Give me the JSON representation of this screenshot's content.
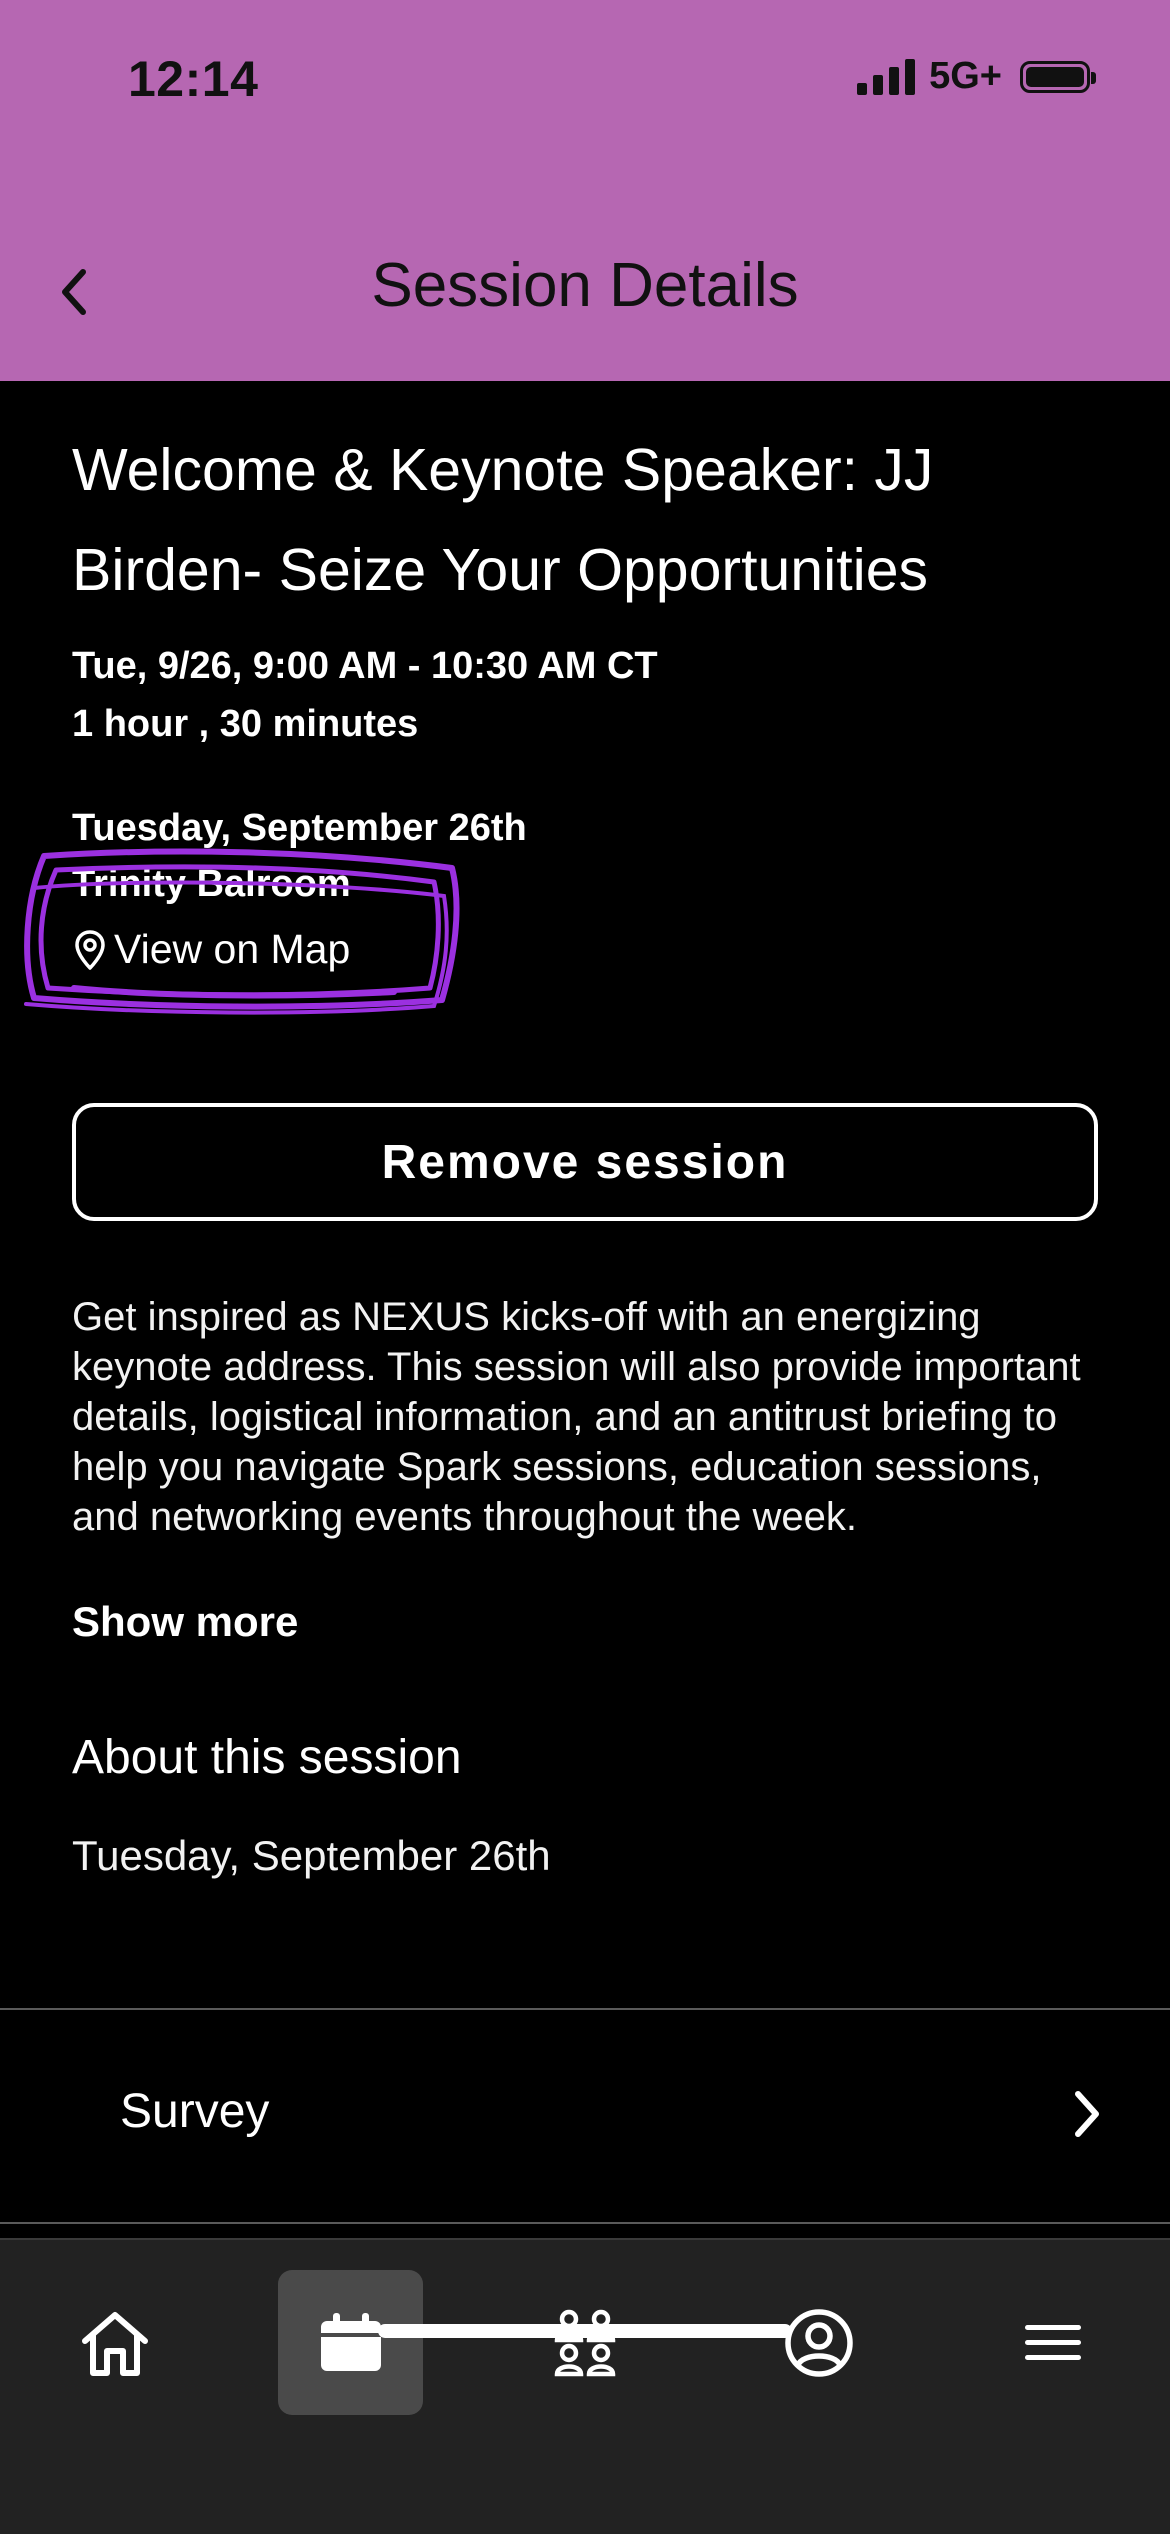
{
  "status_bar": {
    "time": "12:14",
    "network": "5G+"
  },
  "header": {
    "title": "Session Details"
  },
  "session": {
    "title": "Welcome & Keynote Speaker: JJ Birden- Seize Your Opportunities",
    "datetime": "Tue, 9/26, 9:00 AM - 10:30 AM CT",
    "duration": "1 hour , 30 minutes",
    "day": "Tuesday, September 26th",
    "room": "Trinity Balroom",
    "map_link": "View on Map",
    "remove_label": "Remove session",
    "description": "Get inspired as NEXUS kicks-off with an energizing keynote address. This session will also provide important details, logistical information, and an antitrust briefing to help you navigate Spark sessions, education sessions, and networking events throughout the week.",
    "show_more": "Show more"
  },
  "about": {
    "heading": "About this session",
    "date": "Tuesday, September 26th"
  },
  "survey": {
    "label": "Survey"
  },
  "tabbar": {
    "items": [
      {
        "icon": "home-icon",
        "active": false
      },
      {
        "icon": "calendar-icon",
        "active": true
      },
      {
        "icon": "people-icon",
        "active": false
      },
      {
        "icon": "profile-icon",
        "active": false
      },
      {
        "icon": "menu-icon",
        "active": false
      }
    ]
  },
  "colors": {
    "header_bg": "#b667b2",
    "background": "#000000",
    "annotation": "#9b30e0",
    "tabbar_bg": "#222222"
  }
}
